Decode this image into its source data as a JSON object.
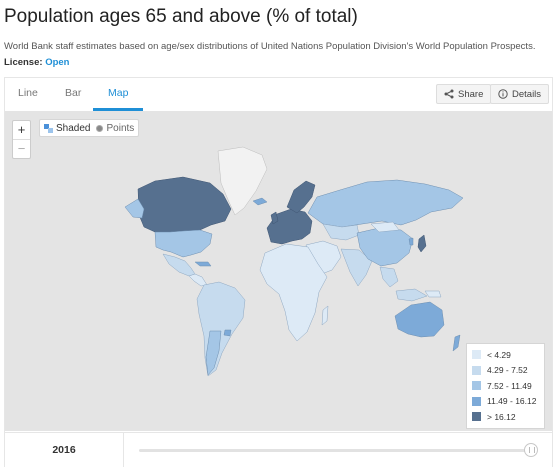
{
  "header": {
    "title": "Population ages 65 and above (% of total)",
    "description": "World Bank staff estimates based on age/sex distributions of United Nations Population Division's World Population Prospects.",
    "license_label": "License:",
    "license_value": "Open"
  },
  "tabs": [
    {
      "label": "Line",
      "active": false
    },
    {
      "label": "Bar",
      "active": false
    },
    {
      "label": "Map",
      "active": true
    }
  ],
  "actions": {
    "share_label": "Share",
    "details_label": "Details"
  },
  "map_controls": {
    "zoom_in": "+",
    "zoom_out": "−",
    "shaded_label": "Shaded",
    "points_label": "Points",
    "selected_mode": "Shaded"
  },
  "legend": [
    {
      "label": "< 4.29",
      "color": "#ddeaf6"
    },
    {
      "label": "4.29 - 7.52",
      "color": "#c6dbee"
    },
    {
      "label": "7.52 - 11.49",
      "color": "#a4c6e6"
    },
    {
      "label": "11.49 - 16.12",
      "color": "#7daad8"
    },
    {
      "label": "> 16.12",
      "color": "#56708f"
    }
  ],
  "colors": {
    "accent": "#1f8fd6",
    "ocean": "#e4e4e4",
    "no_data": "#f2f2f2"
  },
  "timeline": {
    "year": "2016",
    "position": 1.0
  }
}
